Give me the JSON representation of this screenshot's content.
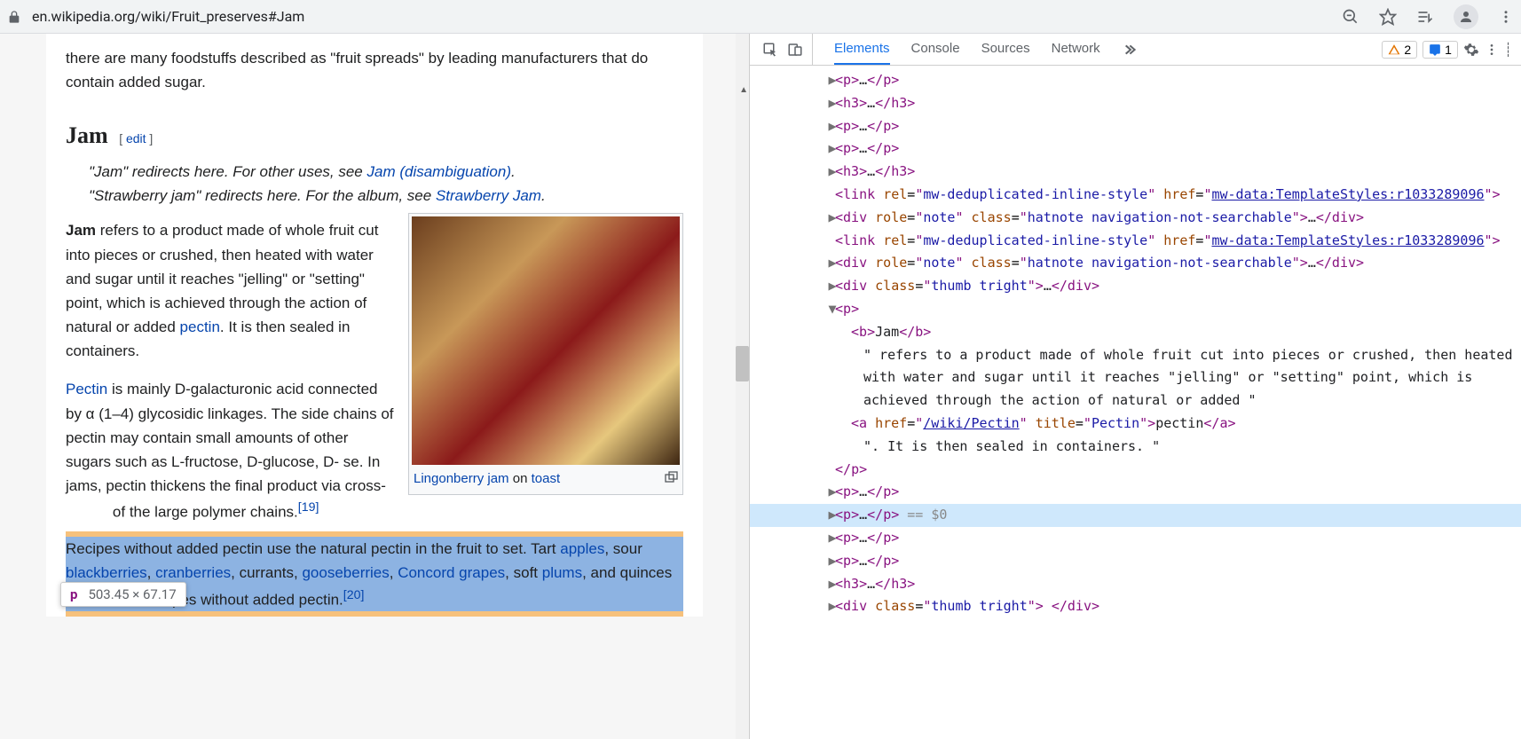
{
  "browser": {
    "url": "en.wikipedia.org/wiki/Fruit_preserves#Jam"
  },
  "article": {
    "intro_frag": "there are many foodstuffs described as \"fruit spreads\" by leading manufacturers that do contain added sugar.",
    "heading": "Jam",
    "edit_open": "[ ",
    "edit_link": "edit",
    "edit_close": " ]",
    "hatnote1_pre": "\"Jam\" redirects here. For other uses, see ",
    "hatnote1_link": "Jam (disambiguation)",
    "hatnote1_post": ".",
    "hatnote2_pre": "\"Strawberry jam\" redirects here. For the album, see ",
    "hatnote2_link": "Strawberry Jam",
    "hatnote2_post": ".",
    "p1_bold": "Jam",
    "p1_text_a": " refers to a product made of whole fruit cut into pieces or crushed, then heated with water and sugar until it reaches \"jelling\" or \"setting\" point, which is achieved through the action of natural or added ",
    "p1_link_pectin": "pectin",
    "p1_text_b": ". It is then sealed in containers.",
    "thumb_caption_link1": "Lingonberry jam",
    "thumb_caption_mid": " on ",
    "thumb_caption_link2": "toast",
    "p2_link": "Pectin",
    "p2_text_a": " is mainly D-galacturonic acid connected by α (1–4) glycosidic linkages. The side chains of pectin may contain small amounts of other sugars such as L-fructose, D-glucose, D-",
    "p2_text_b": "se. In jams, pectin thickens the final product via cross-",
    "p2_text_c": " of the large polymer chains.",
    "p2_cite": "[19]",
    "p3_text_a": "Recipes without added pectin use the natural pectin in the fruit to set. Tart ",
    "p3_link_apples": "apples",
    "p3_text_b": ", sour ",
    "p3_link_blackberries": "blackberries",
    "p3_text_c": ", ",
    "p3_link_cranberries": "cranberries",
    "p3_text_d": ", currants, ",
    "p3_link_gooseberries": "gooseberries",
    "p3_text_e": ", ",
    "p3_link_concord": "Concord grapes",
    "p3_text_f": ", soft ",
    "p3_link_plums": "plums",
    "p3_text_g": ", and quinces work well in recipes without added pectin.",
    "p3_cite": "[20]"
  },
  "tooltip": {
    "tag": "p",
    "dims": "503.45 × 67.17"
  },
  "devtools": {
    "tabs": [
      "Elements",
      "Console",
      "Sources",
      "Network"
    ],
    "warn_count": "2",
    "info_count": "1",
    "link_href": "mw-data:TemplateStyles:r1033289096",
    "pectin_href": "/wiki/Pectin",
    "pectin_title": "Pectin",
    "pectin_text": "pectin",
    "p_bold": "Jam",
    "p_text1": "\" refers to a product made of whole fruit cut into pieces or crushed, then heated with water and sugar until it reaches \"jelling\" or \"setting\" point, which is achieved through the action of natural or added \"",
    "p_text2": "\". It is then sealed in containers. \"",
    "selected_marker": "== $0"
  }
}
